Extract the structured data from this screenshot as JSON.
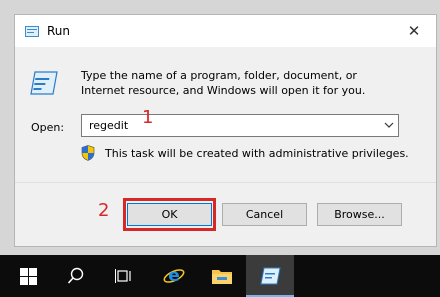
{
  "window": {
    "title": "Run",
    "close_glyph": "✕"
  },
  "description": "Type the name of a program, folder, document, or Internet resource, and Windows will open it for you.",
  "open": {
    "label": "Open:",
    "value": "regedit"
  },
  "privilege_note": "This task will be created with administrative privileges.",
  "buttons": {
    "ok": "OK",
    "cancel": "Cancel",
    "browse": "Browse..."
  },
  "annotations": {
    "step1": "1",
    "step2": "2"
  },
  "colors": {
    "annotation": "#d72828",
    "taskbar": "#0c0c0c"
  },
  "taskbar": {
    "items": [
      "start-icon",
      "search-icon",
      "task-view-icon",
      "internet-explorer-icon",
      "file-explorer-icon",
      "run-icon"
    ]
  }
}
